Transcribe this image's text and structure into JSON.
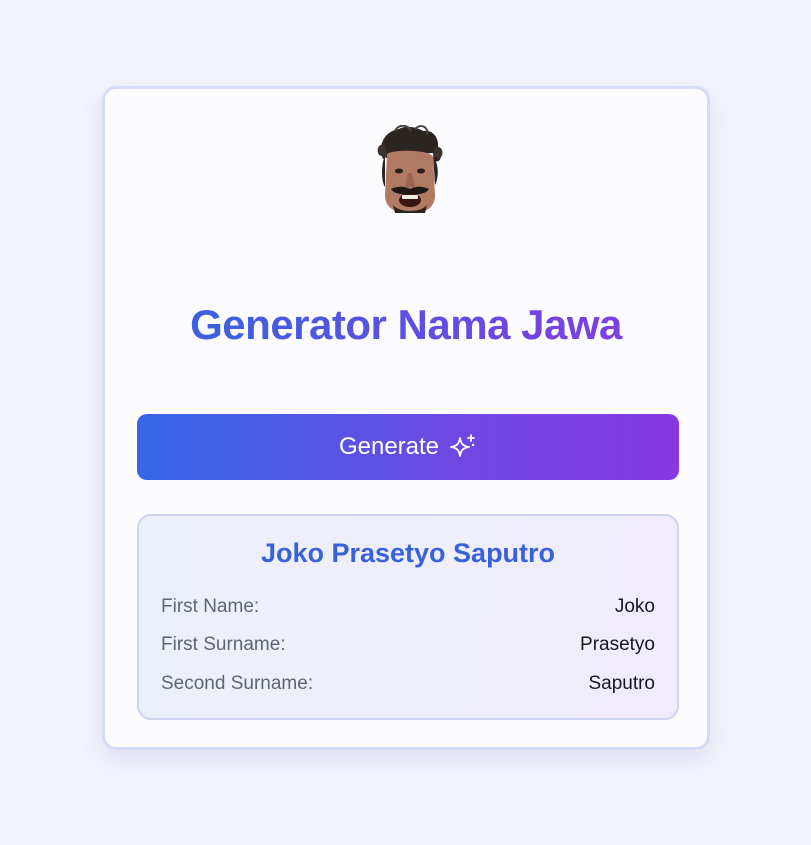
{
  "app": {
    "title": "Generator Nama Jawa"
  },
  "avatar": {
    "alt": "Javanese man avatar"
  },
  "actions": {
    "generate_label": "Generate",
    "generate_icon": "sparkle-icon"
  },
  "result": {
    "full_name": "Joko Prasetyo Saputro",
    "rows": [
      {
        "label": "First Name:",
        "value": "Joko"
      },
      {
        "label": "First Surname:",
        "value": "Prasetyo"
      },
      {
        "label": "Second Surname:",
        "value": "Saputro"
      }
    ]
  },
  "colors": {
    "accent_blue": "#3366e6",
    "accent_purple": "#8638e2",
    "name_color": "#3961d8",
    "page_background": "#f3f3fd"
  }
}
